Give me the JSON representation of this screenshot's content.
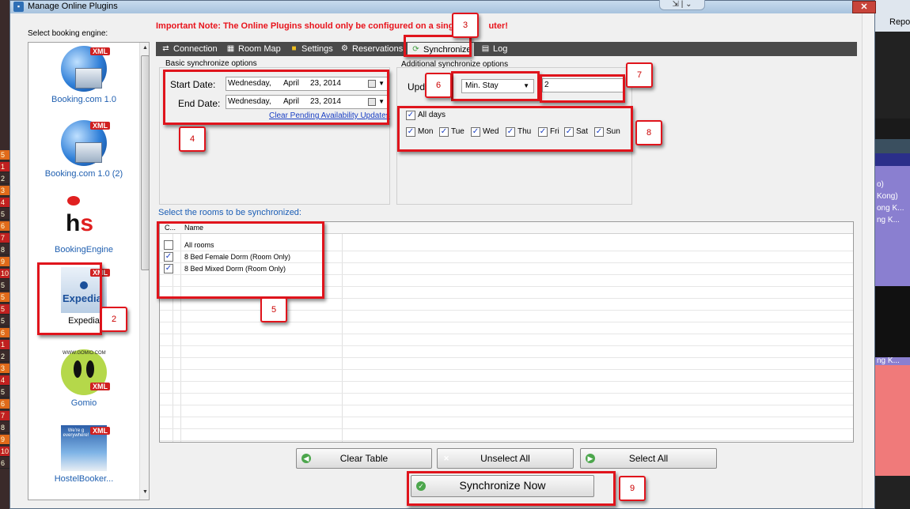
{
  "window": {
    "title": "Manage Online Plugins"
  },
  "note": {
    "text": "Important Note:  The Online Plugins should only be configured on a sing",
    "text_tail": "uter!"
  },
  "engines": {
    "label": "Select booking engine:",
    "items": [
      {
        "name": "Booking.com 1.0",
        "badge": "XML"
      },
      {
        "name": "Booking.com 1.0 (2)",
        "badge": "XML"
      },
      {
        "name": "BookingEngine"
      },
      {
        "name": "Expedia",
        "badge": "XML",
        "logo_text": "Expedia"
      },
      {
        "name": "Gomio",
        "badge": "XML",
        "logo_text": "WWW.GOMIO.COM"
      },
      {
        "name": "HostelBooker...",
        "badge": "XML",
        "logo_text": "We're g everywhere!"
      }
    ]
  },
  "tabs": [
    {
      "label": "Connection",
      "icon": "connection-icon"
    },
    {
      "label": "Room Map",
      "icon": "map-icon"
    },
    {
      "label": "Settings",
      "icon": "gear-icon"
    },
    {
      "label": "Reservations",
      "icon": "reservations-icon"
    },
    {
      "label": "Synchronize",
      "icon": "sync-icon",
      "active": true
    },
    {
      "label": "Log",
      "icon": "log-icon"
    }
  ],
  "basic": {
    "title": "Basic synchronize options",
    "start_label": "Start Date:",
    "end_label": "End Date:",
    "start": {
      "weekday": "Wednesday,",
      "month": "April",
      "day_year": "23, 2014"
    },
    "end": {
      "weekday": "Wednesday,",
      "month": "April",
      "day_year": "23, 2014"
    },
    "clear_link": "Clear Pending Availability Updates"
  },
  "additional": {
    "title": "Additional synchronize options",
    "update_label": "Upd",
    "field_select": "Min. Stay",
    "value": "2",
    "all_days": {
      "label": "All days",
      "checked": true
    },
    "days": [
      {
        "label": "Mon",
        "checked": true
      },
      {
        "label": "Tue",
        "checked": true
      },
      {
        "label": "Wed",
        "checked": true
      },
      {
        "label": "Thu",
        "checked": true
      },
      {
        "label": "Fri",
        "checked": true
      },
      {
        "label": "Sat",
        "checked": true
      },
      {
        "label": "Sun",
        "checked": true
      }
    ]
  },
  "rooms": {
    "title": "Select the rooms to be synchronized:",
    "columns": [
      "C...",
      "Name"
    ],
    "rows": [
      {
        "name": "All rooms",
        "checked": false
      },
      {
        "name": "8 Bed Female Dorm (Room Only)",
        "checked": true
      },
      {
        "name": "8 Bed Mixed Dorm (Room Only)",
        "checked": true
      }
    ]
  },
  "buttons": {
    "clear_table": "Clear Table",
    "unselect_all": "Unselect All",
    "select_all": "Select All",
    "synchronize_now": "Synchronize Now"
  },
  "annotations": [
    "2",
    "3",
    "4",
    "5",
    "6",
    "7",
    "8",
    "9"
  ],
  "background": {
    "left_cells": [
      "5",
      "1",
      "2",
      "3",
      "4",
      "5",
      "6",
      "7",
      "8",
      "9",
      "10",
      "5",
      "5",
      "5",
      "5",
      "6",
      "1",
      "2",
      "3",
      "4",
      "5",
      "6",
      "7",
      "8",
      "9",
      "10",
      "6"
    ],
    "right_text": "Repor",
    "right_labels": [
      "o)",
      "Kong)",
      "ong K...",
      "ng K...",
      "ng K..."
    ]
  },
  "colors": {
    "note_red": "#e8141c",
    "annotation_red": "#e0141c",
    "link_blue": "#1a3fc4",
    "tab_bar": "#4a4a4a"
  }
}
